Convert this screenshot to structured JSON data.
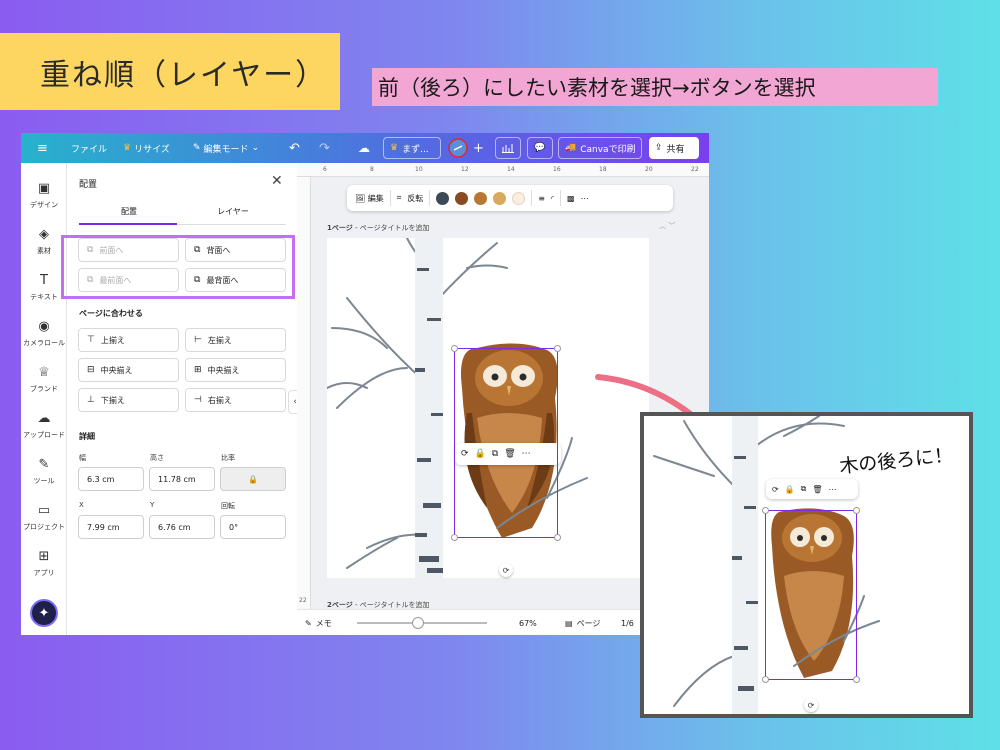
{
  "heading": "重ね順（レイヤー）",
  "instruction": "前（後ろ）にしたい素材を選択→ボタンを選択",
  "topbar": {
    "menu_icon": "hamburger-icon",
    "file": "ファイル",
    "resize": "リサイズ",
    "edit_mode": "編集モード",
    "doc_title": "まず...",
    "print": "Canvaで印刷",
    "share": "共有"
  },
  "rail": [
    {
      "label": "デザイン",
      "icon": "layout-icon"
    },
    {
      "label": "素材",
      "icon": "shapes-icon"
    },
    {
      "label": "テキスト",
      "icon": "text-icon"
    },
    {
      "label": "カメラロール",
      "icon": "camera-icon"
    },
    {
      "label": "ブランド",
      "icon": "brand-icon"
    },
    {
      "label": "アップロード",
      "icon": "cloud-upload-icon"
    },
    {
      "label": "ツール",
      "icon": "pen-icon"
    },
    {
      "label": "プロジェクト",
      "icon": "folder-icon"
    },
    {
      "label": "アプリ",
      "icon": "apps-icon"
    }
  ],
  "panel": {
    "title": "配置",
    "tabs": [
      "配置",
      "レイヤー"
    ],
    "order_buttons": [
      {
        "label": "前面へ",
        "enabled": false
      },
      {
        "label": "背面へ",
        "enabled": true
      },
      {
        "label": "最前面へ",
        "enabled": false
      },
      {
        "label": "最背面へ",
        "enabled": true
      }
    ],
    "align_section": "ページに合わせる",
    "align_buttons": [
      "上揃え",
      "左揃え",
      "中央揃え",
      "中央揃え",
      "下揃え",
      "右揃え"
    ],
    "details_section": "詳細",
    "width_label": "幅",
    "width_value": "6.3 cm",
    "height_label": "高さ",
    "height_value": "11.78 cm",
    "ratio_label": "比率",
    "x_label": "X",
    "x_value": "7.99 cm",
    "y_label": "Y",
    "y_value": "6.76 cm",
    "rotate_label": "回転",
    "rotate_value": "0°"
  },
  "ruler": [
    "6",
    "8",
    "10",
    "12",
    "14",
    "16",
    "18",
    "20",
    "22"
  ],
  "ruler_left": [
    "22"
  ],
  "context_toolbar": {
    "edit": "編集",
    "flip": "反転",
    "colors": [
      "#3b4a55",
      "#8a4a22",
      "#b87835",
      "#d9a95e",
      "#fbeee0"
    ]
  },
  "canvas": {
    "page1_num": "1ページ",
    "page1_title": "ページタイトルを追加",
    "page2_num": "2ページ",
    "page2_title": "ページタイトルを追加"
  },
  "bottombar": {
    "notes": "メモ",
    "zoom": "67%",
    "pages": "ページ",
    "page_count": "1/6"
  },
  "inset_note": "木の後ろに！"
}
